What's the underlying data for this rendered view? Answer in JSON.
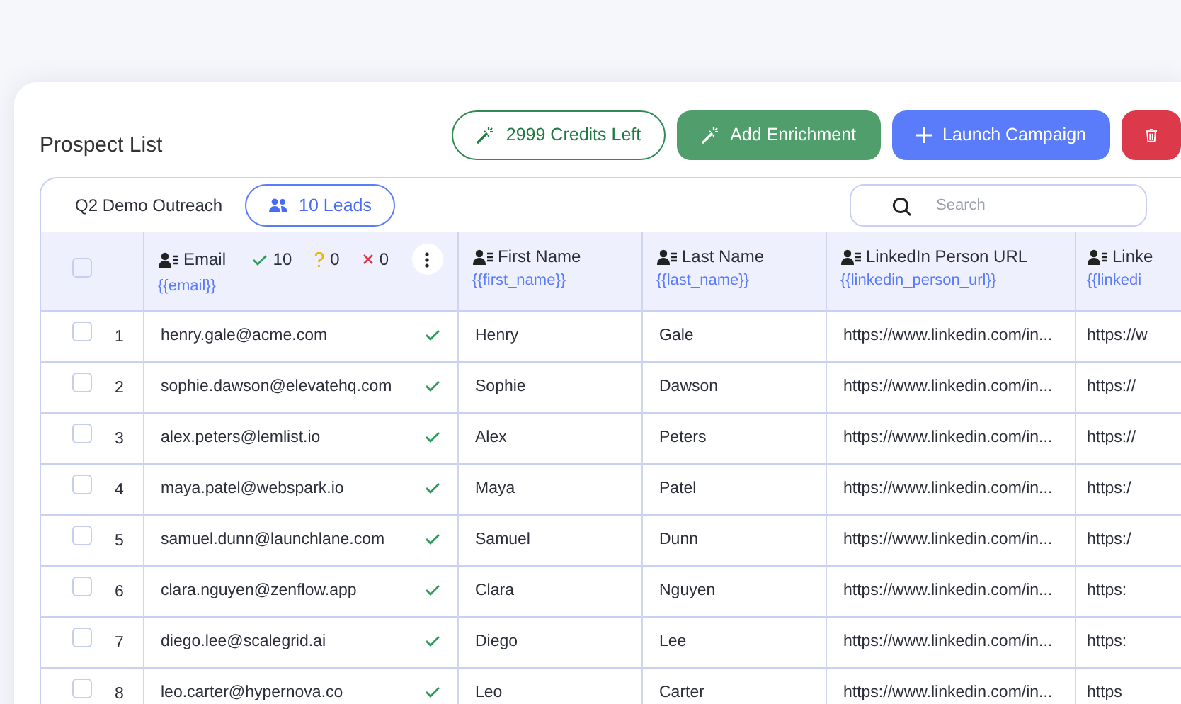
{
  "title": "Prospect List",
  "actions": [
    {
      "kind": "credits",
      "label": "2999 Credits Left"
    },
    {
      "kind": "enrich",
      "label": "Add Enrichment"
    },
    {
      "kind": "launch",
      "label": "Launch Campaign"
    },
    {
      "kind": "delete"
    }
  ],
  "select_all": {
    "checked": false
  },
  "list_name": "Q2 Demo Outreach",
  "leads_badge": "10 Leads",
  "search": {
    "placeholder": "Search"
  },
  "email_stats": {
    "valid": "10",
    "unknown": "0",
    "invalid": "0"
  },
  "columns": [
    {
      "label": "Email",
      "variable": "{{email}}"
    },
    {
      "label": "First Name",
      "variable": "{{first_name}}"
    },
    {
      "label": "Last Name",
      "variable": "{{last_name}}"
    },
    {
      "label": "LinkedIn Person URL",
      "variable": "{{linkedin_person_url}}"
    },
    {
      "label": "Linke",
      "variable": "{{linkedi"
    }
  ],
  "rows": [
    {
      "checked": false,
      "number": "1",
      "email": "henry.gale@acme.com",
      "verified": true,
      "first_name": "Henry",
      "last_name": "Gale",
      "linkedin_url": "https://www.linkedin.com/in...",
      "column_5": "https://w"
    },
    {
      "checked": false,
      "number": "2",
      "email": "sophie.dawson@elevatehq.com",
      "verified": true,
      "first_name": "Sophie",
      "last_name": "Dawson",
      "linkedin_url": "https://www.linkedin.com/in...",
      "column_5": "https://"
    },
    {
      "checked": false,
      "number": "3",
      "email": "alex.peters@lemlist.io",
      "verified": true,
      "first_name": "Alex",
      "last_name": "Peters",
      "linkedin_url": "https://www.linkedin.com/in...",
      "column_5": "https://"
    },
    {
      "checked": false,
      "number": "4",
      "email": "maya.patel@webspark.io",
      "verified": true,
      "first_name": "Maya",
      "last_name": "Patel",
      "linkedin_url": "https://www.linkedin.com/in...",
      "column_5": "https:/"
    },
    {
      "checked": false,
      "number": "5",
      "email": "samuel.dunn@launchlane.com",
      "verified": true,
      "first_name": "Samuel",
      "last_name": "Dunn",
      "linkedin_url": "https://www.linkedin.com/in...",
      "column_5": "https:/"
    },
    {
      "checked": false,
      "number": "6",
      "email": "clara.nguyen@zenflow.app",
      "verified": true,
      "first_name": "Clara",
      "last_name": "Nguyen",
      "linkedin_url": "https://www.linkedin.com/in...",
      "column_5": "https:"
    },
    {
      "checked": false,
      "number": "7",
      "email": "diego.lee@scalegrid.ai",
      "verified": true,
      "first_name": "Diego",
      "last_name": "Lee",
      "linkedin_url": "https://www.linkedin.com/in...",
      "column_5": "https:"
    },
    {
      "checked": false,
      "number": "8",
      "email": "leo.carter@hypernova.co",
      "verified": true,
      "first_name": "Leo",
      "last_name": "Carter",
      "linkedin_url": "https://www.linkedin.com/in...",
      "column_5": "https"
    }
  ]
}
